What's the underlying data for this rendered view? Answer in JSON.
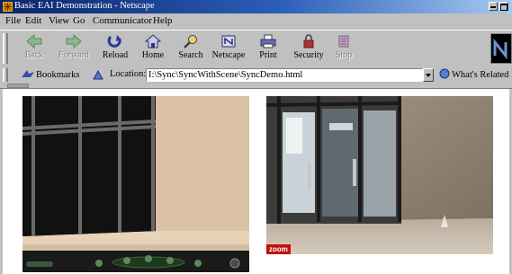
{
  "window": {
    "title": "Basic EAI Demonstration - Netscape"
  },
  "menu": {
    "items": [
      "File",
      "Edit",
      "View",
      "Go",
      "Communicator",
      "Help"
    ]
  },
  "toolbar": {
    "buttons": [
      {
        "label": "Back",
        "icon": "back-arrow-icon",
        "enabled": false
      },
      {
        "label": "Forward",
        "icon": "forward-arrow-icon",
        "enabled": false
      },
      {
        "label": "Reload",
        "icon": "reload-icon",
        "enabled": true
      },
      {
        "label": "Home",
        "icon": "home-icon",
        "enabled": true
      },
      {
        "label": "Search",
        "icon": "search-icon",
        "enabled": true
      },
      {
        "label": "Netscape",
        "icon": "netscape-icon",
        "enabled": true
      },
      {
        "label": "Print",
        "icon": "print-icon",
        "enabled": true
      },
      {
        "label": "Security",
        "icon": "lock-icon",
        "enabled": true
      },
      {
        "label": "Stop",
        "icon": "stop-icon",
        "enabled": false
      }
    ]
  },
  "location_bar": {
    "bookmarks_label": "Bookmarks",
    "location_label": "Location:",
    "url": "I:\\Sync\\SyncWithScene\\SyncDemo.html",
    "related_label": "What's Related"
  },
  "content": {
    "zoom_badge": "zoom"
  },
  "colors": {
    "titlebar_start": "#0a246a",
    "titlebar_end": "#a6caf0",
    "chrome": "#c0c0c0",
    "zoom_badge": "#c01010"
  }
}
